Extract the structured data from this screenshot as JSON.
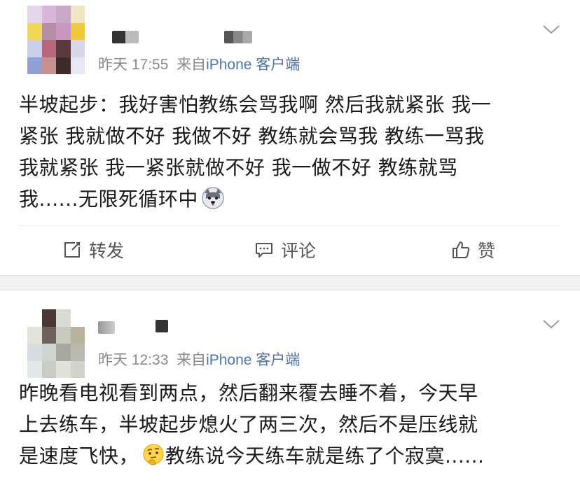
{
  "posts": [
    {
      "time": "昨天 17:55",
      "from_prefix": "来自",
      "source": "iPhone 客户端",
      "content": [
        "半坡起步：我好害怕教练会骂我啊 然后我就紧张 我一",
        "紧张 我就做不好 我做不好 教练就会骂我 教练一骂我",
        "我就紧张 我一紧张就做不好 我一做不好 教练就骂",
        "我......无限死循环中"
      ],
      "emoji": "husky-emoji",
      "actions": {
        "repost": "转发",
        "comment": "评论",
        "like": "赞"
      }
    },
    {
      "time": "昨天 12:33",
      "from_prefix": "来自",
      "source": "iPhone 客户端",
      "content": [
        "昨晚看电视看到两点，然后翻来覆去睡不着，今天早",
        "上去练车，半坡起步熄火了两三次，然后不是压线就",
        "是速度飞快，",
        "教练说今天练车就是练了个寂寞......"
      ],
      "emoji": "thinking-face-emoji"
    }
  ],
  "colors": {
    "source_link": "#4f74a6",
    "meta": "#8a8a8a",
    "text": "#1a1a1a",
    "separator": "#f2f2f2"
  }
}
